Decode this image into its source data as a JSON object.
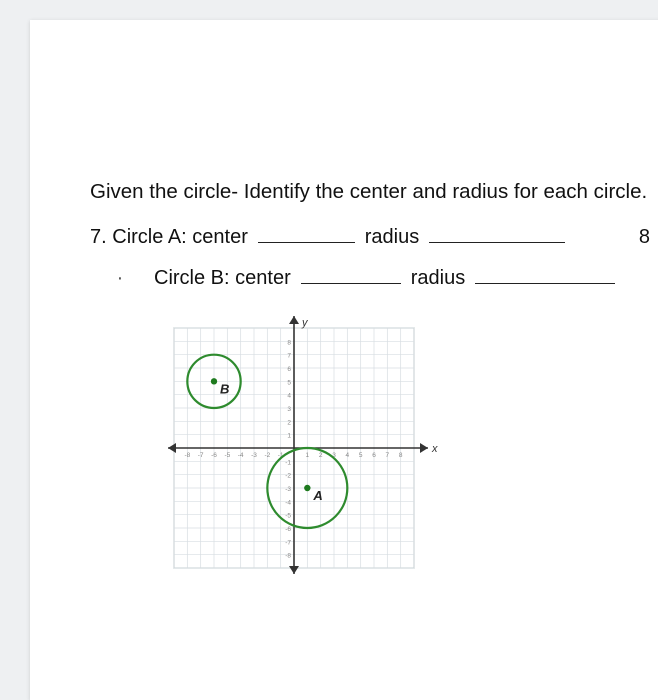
{
  "instruction": "Given the circle- Identify the center and radius for each circle.",
  "q7": {
    "number": "7.",
    "circle_label": "Circle A:",
    "center_label": "center",
    "radius_label": "radius",
    "right_partial": "8"
  },
  "qB": {
    "circle_label": "Circle B:",
    "center_label": "center",
    "radius_label": "radius"
  },
  "axes": {
    "y": "y",
    "x": "x"
  },
  "ticks": {
    "neg": [
      "-8",
      "-7",
      "-6",
      "-5",
      "-4",
      "-3",
      "-2",
      "-1"
    ],
    "pos": [
      "1",
      "2",
      "3",
      "4",
      "5",
      "6",
      "7",
      "8"
    ]
  },
  "chart_data": {
    "type": "scatter",
    "title": "",
    "xlabel": "x",
    "ylabel": "y",
    "xlim": [
      -9,
      9
    ],
    "ylim": [
      -9,
      9
    ],
    "series": [
      {
        "name": "Circle A",
        "center": [
          1,
          -3
        ],
        "radius": 3,
        "label": "A"
      },
      {
        "name": "Circle B",
        "center": [
          -6,
          5
        ],
        "radius": 2,
        "label": "B"
      }
    ]
  }
}
